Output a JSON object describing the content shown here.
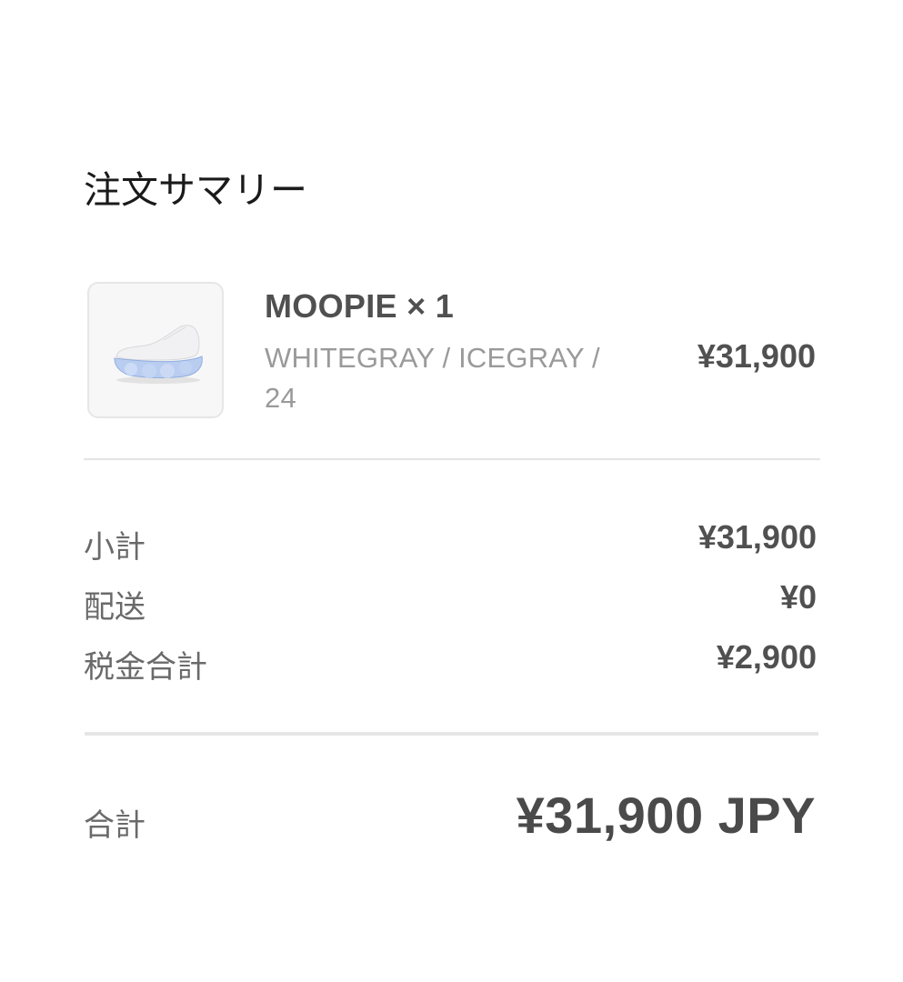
{
  "summary": {
    "title": "注文サマリー"
  },
  "line_item": {
    "name": "MOOPIE × 1",
    "variant": "WHITEGRAY / ICEGRAY / 24",
    "price": "¥31,900",
    "thumbnail_icon": "sneaker-thumbnail-image"
  },
  "costs": [
    {
      "label": "小計",
      "value": "¥31,900"
    },
    {
      "label": "配送",
      "value": "¥0"
    },
    {
      "label": "税金合計",
      "value": "¥2,900"
    }
  ],
  "total": {
    "label": "合計",
    "value": "¥31,900 JPY"
  },
  "colors": {
    "background": "#ffffff",
    "text_primary": "#505050",
    "text_secondary": "#9a9a9a",
    "divider": "#e4e4e4",
    "sole_accent": "#a9c4ee"
  }
}
